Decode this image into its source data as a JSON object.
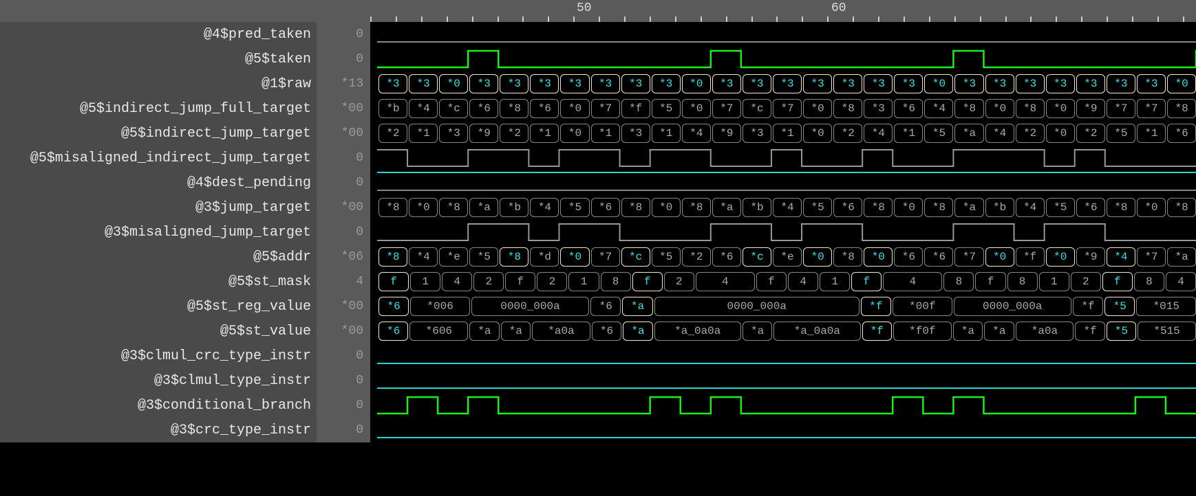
{
  "ruler": {
    "labels": [
      {
        "pos": 302,
        "text": "50"
      },
      {
        "pos": 672,
        "text": "60"
      }
    ],
    "tick_count": 34,
    "tick_spacing": 36.9
  },
  "signals": [
    {
      "name": "@4$pred_taken",
      "value": "0",
      "type": "flat_low"
    },
    {
      "name": "@5$taken",
      "value": "0",
      "type": "pulse_green",
      "pulses": [
        [
          3,
          4
        ],
        [
          11,
          12
        ],
        [
          19,
          20
        ],
        [
          27,
          28
        ]
      ]
    },
    {
      "name": "@1$raw",
      "value": "*13",
      "type": "bus",
      "cells": [
        {
          "t": "*3",
          "h": 1
        },
        {
          "t": "*3",
          "h": 1
        },
        {
          "t": "*0",
          "h": 1
        },
        {
          "t": "*3",
          "h": 1
        },
        {
          "t": "*3",
          "h": 1
        },
        {
          "t": "*3",
          "h": 1
        },
        {
          "t": "*3",
          "h": 1
        },
        {
          "t": "*3",
          "h": 1
        },
        {
          "t": "*3",
          "h": 1
        },
        {
          "t": "*3",
          "h": 1
        },
        {
          "t": "*0",
          "h": 1
        },
        {
          "t": "*3",
          "h": 1
        },
        {
          "t": "*3",
          "h": 1
        },
        {
          "t": "*3",
          "h": 1
        },
        {
          "t": "*3",
          "h": 1
        },
        {
          "t": "*3",
          "h": 1
        },
        {
          "t": "*3",
          "h": 1
        },
        {
          "t": "*3",
          "h": 1
        },
        {
          "t": "*0",
          "h": 1
        },
        {
          "t": "*3",
          "h": 1
        },
        {
          "t": "*3",
          "h": 1
        },
        {
          "t": "*3",
          "h": 1
        },
        {
          "t": "*3",
          "h": 1
        },
        {
          "t": "*3",
          "h": 1
        },
        {
          "t": "*3",
          "h": 1
        },
        {
          "t": "*3",
          "h": 1
        },
        {
          "t": "*0",
          "h": 1
        }
      ]
    },
    {
      "name": "@5$indirect_jump_full_target",
      "value": "*00",
      "type": "bus",
      "cells": [
        {
          "t": "*b"
        },
        {
          "t": "*4"
        },
        {
          "t": "*c"
        },
        {
          "t": "*6"
        },
        {
          "t": "*8"
        },
        {
          "t": "*6"
        },
        {
          "t": "*0"
        },
        {
          "t": "*7"
        },
        {
          "t": "*f"
        },
        {
          "t": "*5"
        },
        {
          "t": "*0"
        },
        {
          "t": "*7"
        },
        {
          "t": "*c"
        },
        {
          "t": "*7"
        },
        {
          "t": "*0"
        },
        {
          "t": "*8"
        },
        {
          "t": "*3"
        },
        {
          "t": "*6"
        },
        {
          "t": "*4"
        },
        {
          "t": "*8"
        },
        {
          "t": "*0"
        },
        {
          "t": "*8"
        },
        {
          "t": "*0"
        },
        {
          "t": "*9"
        },
        {
          "t": "*7"
        },
        {
          "t": "*7"
        },
        {
          "t": "*8"
        }
      ]
    },
    {
      "name": "@5$indirect_jump_target",
      "value": "*00",
      "type": "bus",
      "cells": [
        {
          "t": "*2"
        },
        {
          "t": "*1"
        },
        {
          "t": "*3"
        },
        {
          "t": "*9"
        },
        {
          "t": "*2"
        },
        {
          "t": "*1"
        },
        {
          "t": "*0"
        },
        {
          "t": "*1"
        },
        {
          "t": "*3"
        },
        {
          "t": "*1"
        },
        {
          "t": "*4"
        },
        {
          "t": "*9"
        },
        {
          "t": "*3"
        },
        {
          "t": "*1"
        },
        {
          "t": "*0"
        },
        {
          "t": "*2"
        },
        {
          "t": "*4"
        },
        {
          "t": "*1"
        },
        {
          "t": "*5"
        },
        {
          "t": "*a"
        },
        {
          "t": "*4"
        },
        {
          "t": "*2"
        },
        {
          "t": "*0"
        },
        {
          "t": "*2"
        },
        {
          "t": "*5"
        },
        {
          "t": "*1"
        },
        {
          "t": "*6"
        }
      ]
    },
    {
      "name": "@5$misaligned_indirect_jump_target",
      "value": "0",
      "type": "square_gray",
      "pattern": [
        [
          0,
          1,
          1
        ],
        [
          1,
          3,
          0
        ],
        [
          3,
          5,
          1
        ],
        [
          5,
          6,
          0
        ],
        [
          6,
          8,
          1
        ],
        [
          8,
          9,
          0
        ],
        [
          9,
          11,
          1
        ],
        [
          11,
          13,
          0
        ],
        [
          13,
          14,
          1
        ],
        [
          14,
          16,
          0
        ],
        [
          16,
          17,
          1
        ],
        [
          17,
          19,
          0
        ],
        [
          19,
          22,
          1
        ],
        [
          22,
          23,
          0
        ],
        [
          23,
          24,
          1
        ],
        [
          24,
          27,
          0
        ]
      ]
    },
    {
      "name": "@4$dest_pending",
      "value": "0",
      "type": "flat_low_teal_top"
    },
    {
      "name": "@3$jump_target",
      "value": "*00",
      "type": "bus",
      "cells": [
        {
          "t": "*8"
        },
        {
          "t": "*0"
        },
        {
          "t": "*8"
        },
        {
          "t": "*a"
        },
        {
          "t": "*b"
        },
        {
          "t": "*4"
        },
        {
          "t": "*5"
        },
        {
          "t": "*6"
        },
        {
          "t": "*8"
        },
        {
          "t": "*0"
        },
        {
          "t": "*8"
        },
        {
          "t": "*a"
        },
        {
          "t": "*b"
        },
        {
          "t": "*4"
        },
        {
          "t": "*5"
        },
        {
          "t": "*6"
        },
        {
          "t": "*8"
        },
        {
          "t": "*0"
        },
        {
          "t": "*8"
        },
        {
          "t": "*a"
        },
        {
          "t": "*b"
        },
        {
          "t": "*4"
        },
        {
          "t": "*5"
        },
        {
          "t": "*6"
        },
        {
          "t": "*8"
        },
        {
          "t": "*0"
        },
        {
          "t": "*8"
        }
      ]
    },
    {
      "name": "@3$misaligned_jump_target",
      "value": "0",
      "type": "square_gray",
      "pattern": [
        [
          0,
          3,
          0
        ],
        [
          3,
          5,
          1
        ],
        [
          5,
          6,
          0
        ],
        [
          6,
          8,
          1
        ],
        [
          8,
          11,
          0
        ],
        [
          11,
          13,
          1
        ],
        [
          13,
          14,
          0
        ],
        [
          14,
          16,
          1
        ],
        [
          16,
          19,
          0
        ],
        [
          19,
          21,
          1
        ],
        [
          21,
          22,
          0
        ],
        [
          22,
          24,
          1
        ],
        [
          24,
          27,
          0
        ]
      ]
    },
    {
      "name": "@5$addr",
      "value": "*06",
      "type": "bus",
      "cells": [
        {
          "t": "*8",
          "h": 1
        },
        {
          "t": "*4"
        },
        {
          "t": "*e"
        },
        {
          "t": "*5"
        },
        {
          "t": "*8",
          "h": 1
        },
        {
          "t": "*d"
        },
        {
          "t": "*0",
          "h": 1
        },
        {
          "t": "*7"
        },
        {
          "t": "*c",
          "h": 1
        },
        {
          "t": "*5"
        },
        {
          "t": "*2"
        },
        {
          "t": "*6"
        },
        {
          "t": "*c",
          "h": 1
        },
        {
          "t": "*e"
        },
        {
          "t": "*0",
          "h": 1
        },
        {
          "t": "*8"
        },
        {
          "t": "*0",
          "h": 1
        },
        {
          "t": "*6"
        },
        {
          "t": "*6"
        },
        {
          "t": "*7"
        },
        {
          "t": "*0",
          "h": 1
        },
        {
          "t": "*f"
        },
        {
          "t": "*0",
          "h": 1
        },
        {
          "t": "*9"
        },
        {
          "t": "*4",
          "h": 1
        },
        {
          "t": "*7"
        },
        {
          "t": "*a"
        }
      ]
    },
    {
      "name": "@5$st_mask",
      "value": "4",
      "type": "bus",
      "cells": [
        {
          "t": "f",
          "h": 1
        },
        {
          "t": "1"
        },
        {
          "t": "4"
        },
        {
          "t": "2"
        },
        {
          "t": "f"
        },
        {
          "t": "2"
        },
        {
          "t": "1"
        },
        {
          "t": "8"
        },
        {
          "t": "f",
          "h": 1
        },
        {
          "t": "2"
        },
        {
          "t": "4",
          "w": 2
        },
        {
          "t": "f"
        },
        {
          "t": "4"
        },
        {
          "t": "1"
        },
        {
          "t": "f",
          "h": 1
        },
        {
          "t": "4",
          "w": 2
        },
        {
          "t": "8"
        },
        {
          "t": "f"
        },
        {
          "t": "8"
        },
        {
          "t": "1"
        },
        {
          "t": "2"
        },
        {
          "t": "f",
          "h": 1
        },
        {
          "t": "8"
        },
        {
          "t": "4"
        }
      ]
    },
    {
      "name": "@5$st_reg_value",
      "value": "*00",
      "type": "bus",
      "cells": [
        {
          "t": "*6",
          "h": 1
        },
        {
          "t": "*006",
          "w": 2
        },
        {
          "t": "0000_000a",
          "w": 4
        },
        {
          "t": "*6"
        },
        {
          "t": "*a",
          "h": 1
        },
        {
          "t": "0000_000a",
          "w": 7
        },
        {
          "t": "*f",
          "h": 1
        },
        {
          "t": "*00f",
          "w": 2
        },
        {
          "t": "0000_000a",
          "w": 4
        },
        {
          "t": "*f"
        },
        {
          "t": "*5",
          "h": 1
        },
        {
          "t": "*015",
          "w": 2
        }
      ]
    },
    {
      "name": "@5$st_value",
      "value": "*00",
      "type": "bus",
      "cells": [
        {
          "t": "*6",
          "h": 1
        },
        {
          "t": "*606",
          "w": 2
        },
        {
          "t": "*a"
        },
        {
          "t": "*a"
        },
        {
          "t": "*a0a",
          "w": 2
        },
        {
          "t": "*6"
        },
        {
          "t": "*a",
          "h": 1
        },
        {
          "t": "*a_0a0a",
          "w": 3
        },
        {
          "t": "*a"
        },
        {
          "t": "*a_0a0a",
          "w": 3
        },
        {
          "t": "*f",
          "h": 1
        },
        {
          "t": "*f0f",
          "w": 2
        },
        {
          "t": "*a"
        },
        {
          "t": "*a"
        },
        {
          "t": "*a0a",
          "w": 2
        },
        {
          "t": "*f"
        },
        {
          "t": "*5",
          "h": 1
        },
        {
          "t": "*515",
          "w": 2
        }
      ]
    },
    {
      "name": "@3$clmul_crc_type_instr",
      "value": "0",
      "type": "flat_teal"
    },
    {
      "name": "@3$clmul_type_instr",
      "value": "0",
      "type": "flat_teal"
    },
    {
      "name": "@3$conditional_branch",
      "value": "0",
      "type": "pulse_green_low",
      "pulses": [
        [
          1,
          2
        ],
        [
          3,
          4
        ],
        [
          9,
          10
        ],
        [
          11,
          12
        ],
        [
          17,
          18
        ],
        [
          19,
          20
        ],
        [
          25,
          26
        ]
      ]
    },
    {
      "name": "@3$crc_type_instr",
      "value": "0",
      "type": "flat_teal"
    }
  ]
}
